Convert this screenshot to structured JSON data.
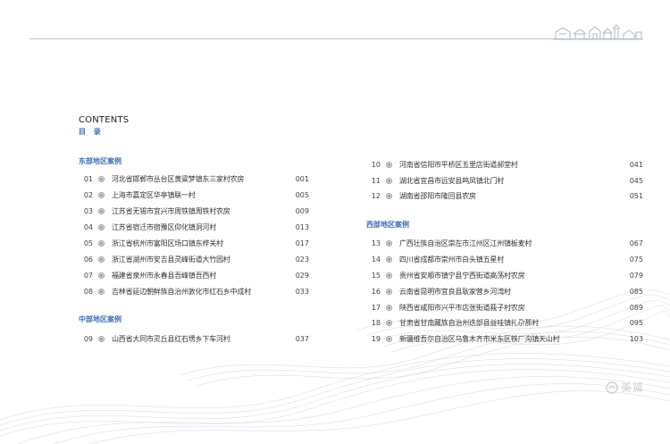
{
  "header": {
    "contents_en": "CONTENTS",
    "contents_cn": "目 录"
  },
  "left_column": {
    "east_heading": "东部地区案例",
    "east": [
      {
        "num": "01",
        "title": "河北省邯郸市丛台区黄粱梦镇东三家村农房",
        "page": "001"
      },
      {
        "num": "02",
        "title": "上海市嘉定区华亭镇联一村",
        "page": "005"
      },
      {
        "num": "03",
        "title": "江苏省无锡市宜兴市周铁镇周铁村农房",
        "page": "009"
      },
      {
        "num": "04",
        "title": "江苏省宿迁市宿豫区仰化镇洞河村",
        "page": "013"
      },
      {
        "num": "05",
        "title": "浙江省杭州市富阳区场口镇东梓关村",
        "page": "017"
      },
      {
        "num": "06",
        "title": "浙江省湖州市安吉县灵峰街道大竹园村",
        "page": "023"
      },
      {
        "num": "07",
        "title": "福建省泉州市永春县吾峰镇吾西村",
        "page": "029"
      },
      {
        "num": "08",
        "title": "吉林省延边朝鲜族自治州敦化市红石乡中成村",
        "page": "033"
      }
    ],
    "central_heading": "中部地区案例",
    "central": [
      {
        "num": "09",
        "title": "山西省大同市灵丘县红石塄乡下车河村",
        "page": "037"
      }
    ]
  },
  "right_column": {
    "central_cont": [
      {
        "num": "10",
        "title": "河南省信阳市平桥区五里店街道郝堂村",
        "page": "041"
      },
      {
        "num": "11",
        "title": "湖北省宜昌市远安县鸣凤镇北门村",
        "page": "045"
      },
      {
        "num": "12",
        "title": "湖南省邵阳市隆回县农房",
        "page": "051"
      }
    ],
    "west_heading": "西部地区案例",
    "west": [
      {
        "num": "13",
        "title": "广西壮族自治区崇左市江州区江州镇板麦村",
        "page": "067"
      },
      {
        "num": "14",
        "title": "四川省成都市崇州市白头镇五星村",
        "page": "075"
      },
      {
        "num": "15",
        "title": "贵州省安顺市镇宁县宁西街道高荡村农房",
        "page": "079"
      },
      {
        "num": "16",
        "title": "云南省昆明市宜良县耿家营乡河湾村",
        "page": "085"
      },
      {
        "num": "17",
        "title": "陕西省咸阳市兴平市店张街道莪子村农房",
        "page": "089"
      },
      {
        "num": "18",
        "title": "甘肃省甘南藏族自治州迭部县益哇镇扎尕那村",
        "page": "095"
      },
      {
        "num": "19",
        "title": "新疆维吾尔自治区乌鲁木齐市米东区铁厂沟镇天山村",
        "page": "103"
      }
    ]
  },
  "watermark": {
    "text": "美篇",
    "icon": "meipian-logo-icon"
  },
  "colors": {
    "accent_blue": "#3d6fb4",
    "rule": "#b8c4d4"
  }
}
